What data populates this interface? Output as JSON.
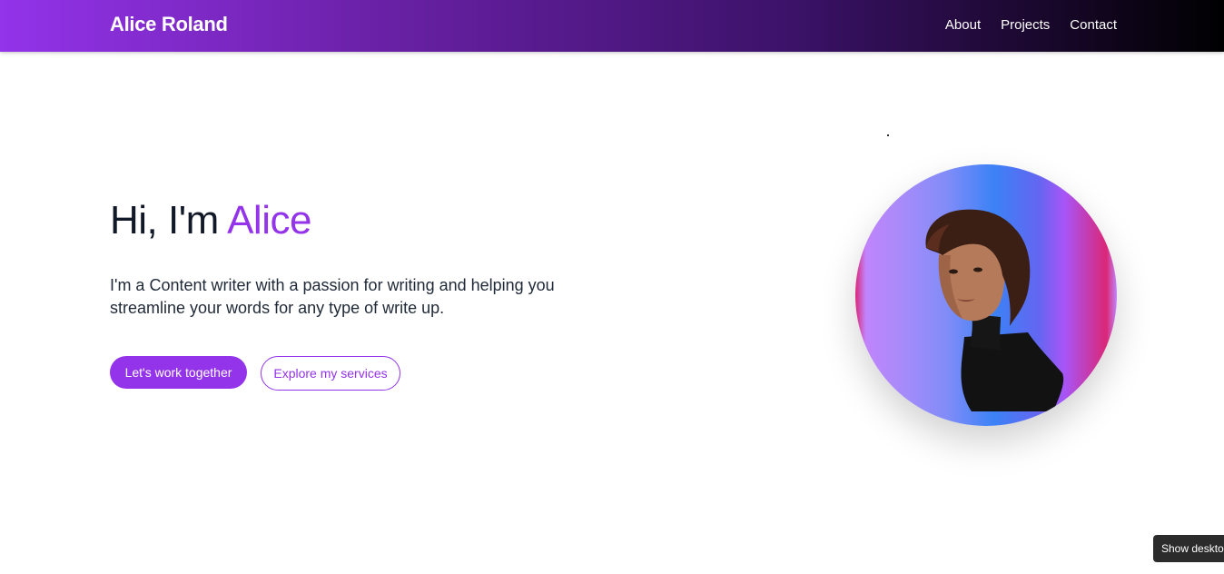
{
  "navbar": {
    "brand": "Alice Roland",
    "links": [
      {
        "label": "About"
      },
      {
        "label": "Projects"
      },
      {
        "label": "Contact"
      }
    ],
    "gradient_colors": [
      "#9333ea",
      "#000000"
    ]
  },
  "hero": {
    "greeting": "Hi, I'm ",
    "name": "Alice",
    "description": "I'm a Content writer with a passion for writing and helping you streamline your words for any type of write up.",
    "primary_button": "Let's work together",
    "secondary_button": "Explore my services",
    "accent_color": "#9333ea"
  },
  "tooltip": {
    "text": "Show desktop"
  }
}
